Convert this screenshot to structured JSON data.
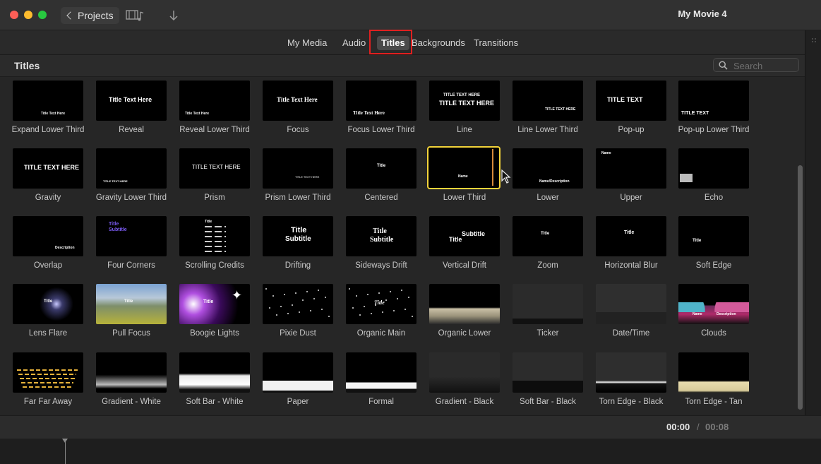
{
  "window": {
    "title": "My Movie 4"
  },
  "toolbar": {
    "projects_label": "Projects"
  },
  "browser_tabs": [
    {
      "label": "My Media"
    },
    {
      "label": "Audio"
    },
    {
      "label": "Titles",
      "active": true
    },
    {
      "label": "Backgrounds"
    },
    {
      "label": "Transitions"
    }
  ],
  "section": {
    "title": "Titles",
    "search_placeholder": "Search"
  },
  "titles": [
    {
      "name": "Expand Lower Third",
      "preview": [
        "Title Text Here"
      ]
    },
    {
      "name": "Reveal",
      "preview": [
        "Title Text Here"
      ]
    },
    {
      "name": "Reveal Lower Third",
      "preview": [
        "Title Text Here"
      ]
    },
    {
      "name": "Focus",
      "preview": [
        "Title Text Here"
      ]
    },
    {
      "name": "Focus Lower Third",
      "preview": [
        "Title Text Here"
      ]
    },
    {
      "name": "Line",
      "preview": [
        "TITLE TEXT HERE",
        "TITLE TEXT HERE"
      ]
    },
    {
      "name": "Line Lower Third",
      "preview": [
        "TITLE TEXT HERE"
      ]
    },
    {
      "name": "Pop-up",
      "preview": [
        "TITLE TEXT"
      ]
    },
    {
      "name": "Pop-up Lower Third",
      "preview": [
        "TITLE TEXT"
      ]
    },
    {
      "name": "Gravity",
      "preview": [
        "TITLE TEXT HERE"
      ]
    },
    {
      "name": "Gravity Lower Third",
      "preview": [
        "TITLE TEXT HERE"
      ]
    },
    {
      "name": "Prism",
      "preview": [
        "TITLE TEXT HERE"
      ]
    },
    {
      "name": "Prism Lower Third",
      "preview": [
        "TITLE TEXT HERE"
      ]
    },
    {
      "name": "Centered",
      "preview": [
        "Title"
      ]
    },
    {
      "name": "Lower Third",
      "preview": [
        "Name"
      ],
      "selected": true
    },
    {
      "name": "Lower",
      "preview": [
        "Name/Description"
      ]
    },
    {
      "name": "Upper",
      "preview": [
        "Name"
      ]
    },
    {
      "name": "Echo",
      "preview": []
    },
    {
      "name": "Overlap",
      "preview": [
        "Description"
      ]
    },
    {
      "name": "Four Corners",
      "preview": [
        "Title",
        "Subtitle"
      ]
    },
    {
      "name": "Scrolling Credits",
      "preview": [
        "Title"
      ]
    },
    {
      "name": "Drifting",
      "preview": [
        "Title",
        "Subtitle"
      ]
    },
    {
      "name": "Sideways Drift",
      "preview": [
        "Title",
        "Subtitle"
      ]
    },
    {
      "name": "Vertical Drift",
      "preview": [
        "Title",
        "Subtitle"
      ]
    },
    {
      "name": "Zoom",
      "preview": [
        "Title"
      ]
    },
    {
      "name": "Horizontal Blur",
      "preview": [
        "Title"
      ]
    },
    {
      "name": "Soft Edge",
      "preview": [
        "Title"
      ]
    },
    {
      "name": "Lens Flare",
      "preview": [
        "Title"
      ]
    },
    {
      "name": "Pull Focus",
      "preview": [
        "Title"
      ]
    },
    {
      "name": "Boogie Lights",
      "preview": [
        "Title"
      ]
    },
    {
      "name": "Pixie Dust",
      "preview": []
    },
    {
      "name": "Organic Main",
      "preview": [
        "Title"
      ]
    },
    {
      "name": "Organic Lower",
      "preview": []
    },
    {
      "name": "Ticker",
      "preview": []
    },
    {
      "name": "Date/Time",
      "preview": []
    },
    {
      "name": "Clouds",
      "preview": [
        "Name",
        "Description"
      ]
    },
    {
      "name": "Far Far Away",
      "preview": []
    },
    {
      "name": "Gradient - White",
      "preview": []
    },
    {
      "name": "Soft Bar - White",
      "preview": []
    },
    {
      "name": "Paper",
      "preview": []
    },
    {
      "name": "Formal",
      "preview": []
    },
    {
      "name": "Gradient - Black",
      "preview": []
    },
    {
      "name": "Soft Bar - Black",
      "preview": []
    },
    {
      "name": "Torn Edge - Black",
      "preview": []
    },
    {
      "name": "Torn Edge - Tan",
      "preview": []
    }
  ],
  "footer": {
    "current_time": "00:00",
    "separator": "/",
    "total_time": "00:08"
  },
  "colors": {
    "selection": "#f3d43a",
    "annotation_box": "#e02020"
  }
}
